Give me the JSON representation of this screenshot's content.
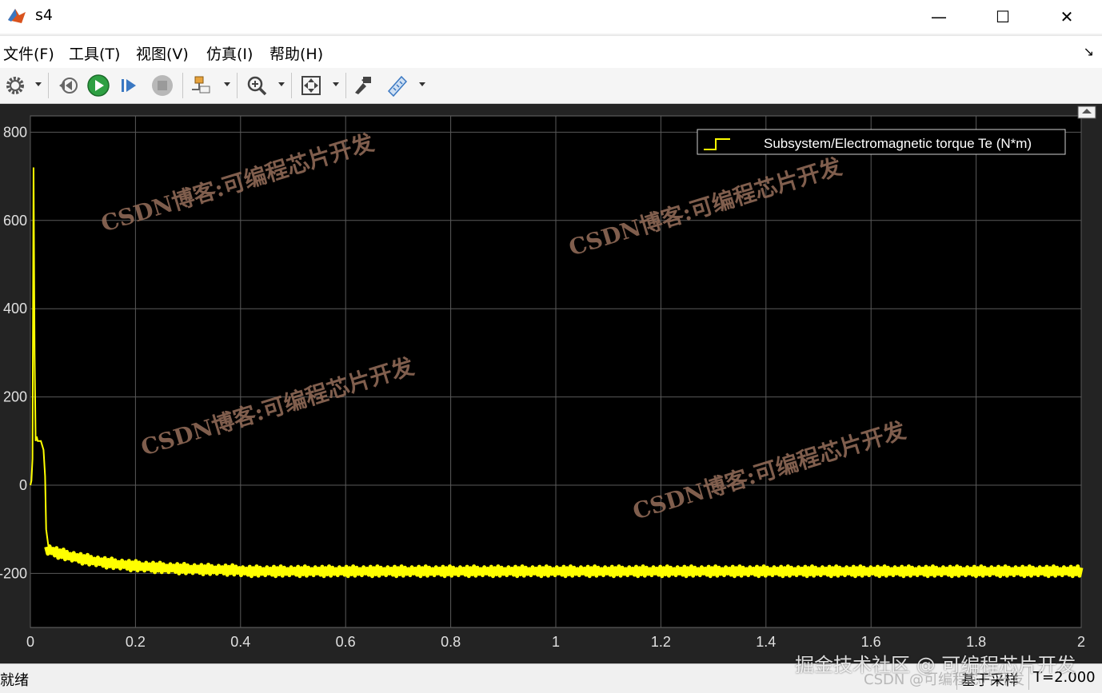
{
  "window": {
    "title": "s4",
    "minimize": "—",
    "maximize": "☐",
    "close": "✕"
  },
  "menu": [
    {
      "label": "文件(F)"
    },
    {
      "label": "工具(T)"
    },
    {
      "label": "视图(V)"
    },
    {
      "label": "仿真(I)"
    },
    {
      "label": "帮助(H)"
    }
  ],
  "toolbar": {
    "icons": [
      "gear-icon",
      "step-back-icon",
      "run-icon",
      "step-forward-icon",
      "stop-icon",
      "signal-selector-icon",
      "zoom-icon",
      "fit-view-icon",
      "highlight-block-icon",
      "measurement-icon"
    ]
  },
  "scope": {
    "legend": "Subsystem/Electromagnetic torque Te (N*m)",
    "trace_color": "#ffff00",
    "background": "#000000",
    "watermarks": [
      "CSDN博客:可编程芯片开发",
      "CSDN博客:可编程芯片开发",
      "CSDN博客:可编程芯片开发",
      "CSDN博客:可编程芯片开发"
    ]
  },
  "chart_data": {
    "type": "line",
    "title": "",
    "xlabel": "",
    "ylabel": "",
    "xlim": [
      0,
      2
    ],
    "ylim": [
      -320,
      800
    ],
    "x_ticks": [
      0,
      0.2,
      0.4,
      0.6,
      0.8,
      1,
      1.2,
      1.4,
      1.6,
      1.8,
      2
    ],
    "x_tick_labels": [
      "0",
      "0.2",
      "0.4",
      "0.6",
      "0.8",
      "1",
      "1.2",
      "1.4",
      "1.6",
      "1.8",
      "2"
    ],
    "y_ticks": [
      800,
      600,
      400,
      200,
      0,
      -200
    ],
    "y_tick_labels": [
      "800",
      "600",
      "400",
      "200",
      "0",
      "-200"
    ],
    "grid": true,
    "legend_position": "top-right",
    "series": [
      {
        "name": "Subsystem/Electromagnetic torque Te (N*m)",
        "x": [
          0,
          0.002,
          0.004,
          0.006,
          0.008,
          0.01,
          0.012,
          0.014,
          0.02,
          0.025,
          0.028,
          0.03,
          0.035,
          0.045,
          0.08,
          0.15,
          0.25,
          0.4,
          0.7,
          1.0,
          1.4,
          1.8,
          2.0
        ],
        "y": [
          0,
          10,
          60,
          720,
          300,
          100,
          110,
          100,
          100,
          80,
          20,
          -100,
          -145,
          -160,
          -170,
          -180,
          -188,
          -192,
          -195,
          -195,
          -195,
          -195,
          -195
        ]
      }
    ]
  },
  "status": {
    "left": "就绪",
    "mode": "基于采样",
    "time": "T=2.000"
  },
  "corner_watermark": "掘金技术社区 @ 可编程芯片开发",
  "corner_watermark_2": "CSDN @可编程芯片开发"
}
